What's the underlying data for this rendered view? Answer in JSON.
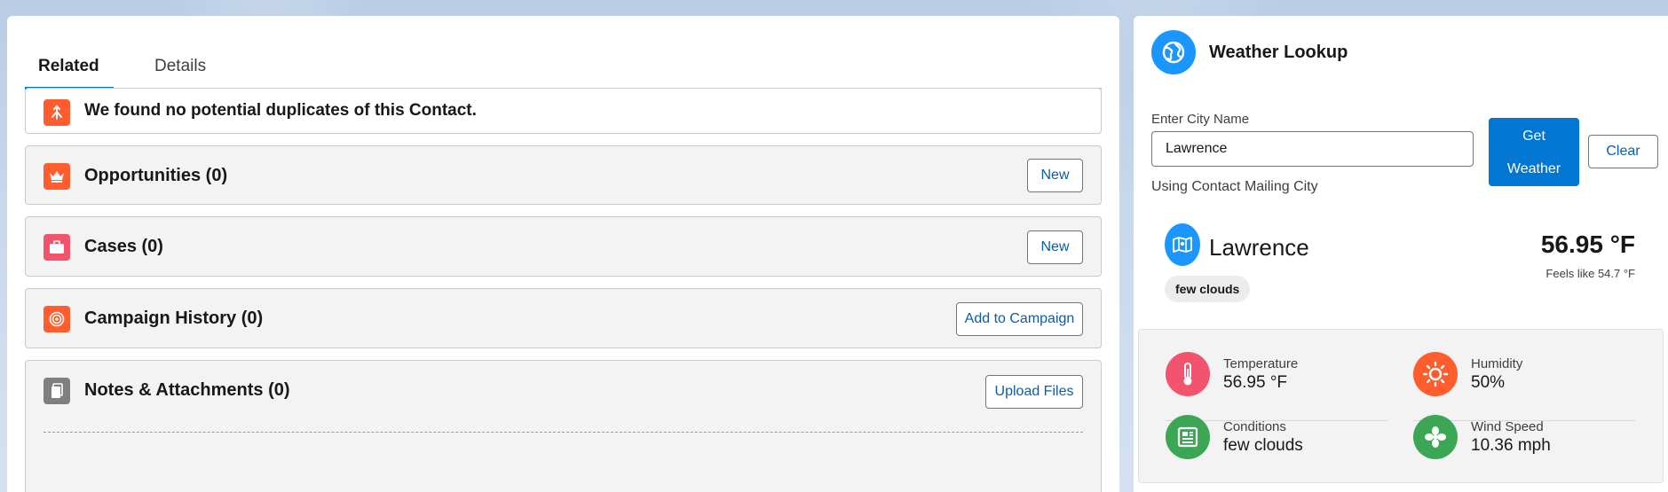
{
  "tabs": [
    {
      "label": "Related",
      "active": true
    },
    {
      "label": "Details",
      "active": false
    }
  ],
  "duplicates": {
    "message": "We found no potential duplicates of this Contact.",
    "icon": "merge-icon",
    "color": "#ff5d2d"
  },
  "related_lists": [
    {
      "title": "Opportunities (0)",
      "button": "New",
      "icon": "crown-icon",
      "color": "#ff5d2d"
    },
    {
      "title": "Cases (0)",
      "button": "New",
      "icon": "briefcase-icon",
      "color": "#f2536d"
    },
    {
      "title": "Campaign History (0)",
      "button": "Add to Campaign",
      "icon": "target-icon",
      "color": "#ff5d2d"
    },
    {
      "title": "Notes & Attachments (0)",
      "button": "Upload Files",
      "icon": "file-icon",
      "color": "#7f7f7f"
    }
  ],
  "weather": {
    "title": "Weather Lookup",
    "input_label": "Enter City Name",
    "input_value": "Lawrence",
    "get_button_line1": "Get",
    "get_button_line2": "Weather",
    "clear_button": "Clear",
    "note": "Using Contact Mailing City",
    "location": "Lawrence",
    "temperature": "56.95 °F",
    "feels_like": "Feels like 54.7 °F",
    "condition": "few clouds",
    "stats": [
      {
        "label": "Temperature",
        "value": "56.95 °F",
        "icon": "thermometer-icon",
        "color": "#f2536d"
      },
      {
        "label": "Humidity",
        "value": "50%",
        "icon": "sun-icon",
        "color": "#ff5d2d"
      },
      {
        "label": "Conditions",
        "value": "few clouds",
        "icon": "news-icon",
        "color": "#3ba755"
      },
      {
        "label": "Wind Speed",
        "value": "10.36 mph",
        "icon": "fan-icon",
        "color": "#3ba755"
      }
    ]
  },
  "colors": {
    "brand": "#0176d3",
    "link": "#0b5cab",
    "globe": "#1b96ff"
  }
}
